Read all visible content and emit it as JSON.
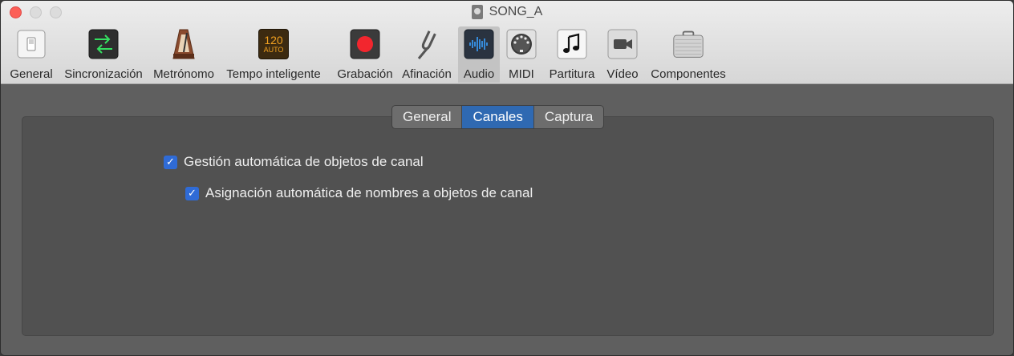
{
  "window": {
    "title": "SONG_A"
  },
  "toolbar": {
    "items": [
      {
        "label": "General",
        "icon": "switch-icon"
      },
      {
        "label": "Sincronización",
        "icon": "sync-arrows-icon"
      },
      {
        "label": "Metrónomo",
        "icon": "metronome-icon"
      },
      {
        "label": "Tempo inteligente",
        "icon": "smart-tempo-icon",
        "icon_text_top": "120",
        "icon_text_bottom": "AUTO"
      },
      {
        "label": "Grabación",
        "icon": "record-icon"
      },
      {
        "label": "Afinación",
        "icon": "tuning-fork-icon"
      },
      {
        "label": "Audio",
        "icon": "audio-waveform-icon",
        "selected": true
      },
      {
        "label": "MIDI",
        "icon": "midi-connector-icon"
      },
      {
        "label": "Partitura",
        "icon": "music-note-icon"
      },
      {
        "label": "Vídeo",
        "icon": "video-camera-icon"
      },
      {
        "label": "Componentes",
        "icon": "briefcase-icon"
      }
    ]
  },
  "tabs": [
    {
      "label": "General",
      "active": false
    },
    {
      "label": "Canales",
      "active": true
    },
    {
      "label": "Captura",
      "active": false
    }
  ],
  "options": {
    "auto_channel_strip": {
      "label": "Gestión automática de objetos de canal",
      "checked": true
    },
    "auto_naming": {
      "label": "Asignación automática de nombres a objetos de canal",
      "checked": true
    }
  },
  "colors": {
    "accent": "#2f69b2",
    "checkbox": "#2f6bd6",
    "panel_bg": "#515151",
    "window_bg": "#5f5f5f"
  }
}
